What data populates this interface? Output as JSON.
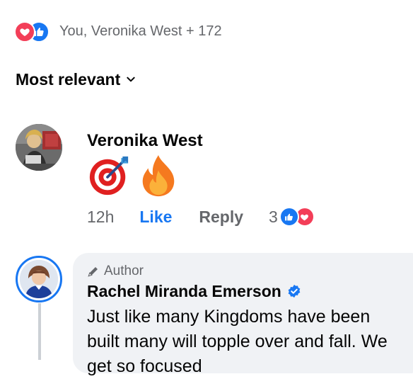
{
  "reactions": {
    "summary": "You, Veronika West + 172",
    "types": [
      "love-icon",
      "like-icon"
    ],
    "colors": {
      "love": "#f33e58",
      "like": "#1877f2"
    }
  },
  "sort": {
    "label": "Most relevant"
  },
  "comments": [
    {
      "author": "Veronika West",
      "emojis": [
        "direct-hit-emoji",
        "fire-emoji"
      ],
      "time": "12h",
      "like_label": "Like",
      "reply_label": "Reply",
      "reaction_count": "3"
    },
    {
      "badge": "Author",
      "author": "Rachel Miranda Emerson",
      "verified": true,
      "text": "Just like many Kingdoms have been built many will topple over and fall. We get so focused"
    }
  ],
  "colors": {
    "accent": "#1877f2",
    "secondary_text": "#65676b",
    "bubble_bg": "#f0f2f5"
  }
}
